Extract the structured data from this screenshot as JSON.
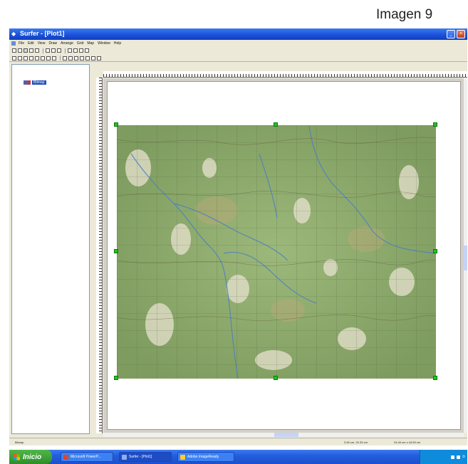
{
  "caption": "Imagen 9",
  "window": {
    "title": "Surfer - [Plot1]",
    "menu": [
      "File",
      "Edit",
      "View",
      "Draw",
      "Arrange",
      "Grid",
      "Map",
      "Window",
      "Help"
    ]
  },
  "tree": {
    "item_label": "Bitmap"
  },
  "status": {
    "left": "Bitmap",
    "coords": "3.45 cm, 20.33 cm",
    "size": "24.40 cm x 18.59 cm"
  },
  "taskbar": {
    "start_label": "Inicio",
    "tasks": [
      {
        "label": "Microsoft PowerP...",
        "color": "#d9482b"
      },
      {
        "label": "Surfer - [Plot1]",
        "color": "#3060c0"
      },
      {
        "label": "Adobe ImageReady",
        "color": "#1f6fb3"
      }
    ]
  },
  "colors": {
    "titlebar": "#1a4fd8",
    "map_green": "#8aa86a",
    "handle": "#22c322",
    "taskbar": "#245edb",
    "start": "#2f8d2b"
  },
  "icons": [
    "surfer-app-icon",
    "minimize-icon",
    "close-icon",
    "bitmap-icon",
    "windows-flag-icon"
  ]
}
